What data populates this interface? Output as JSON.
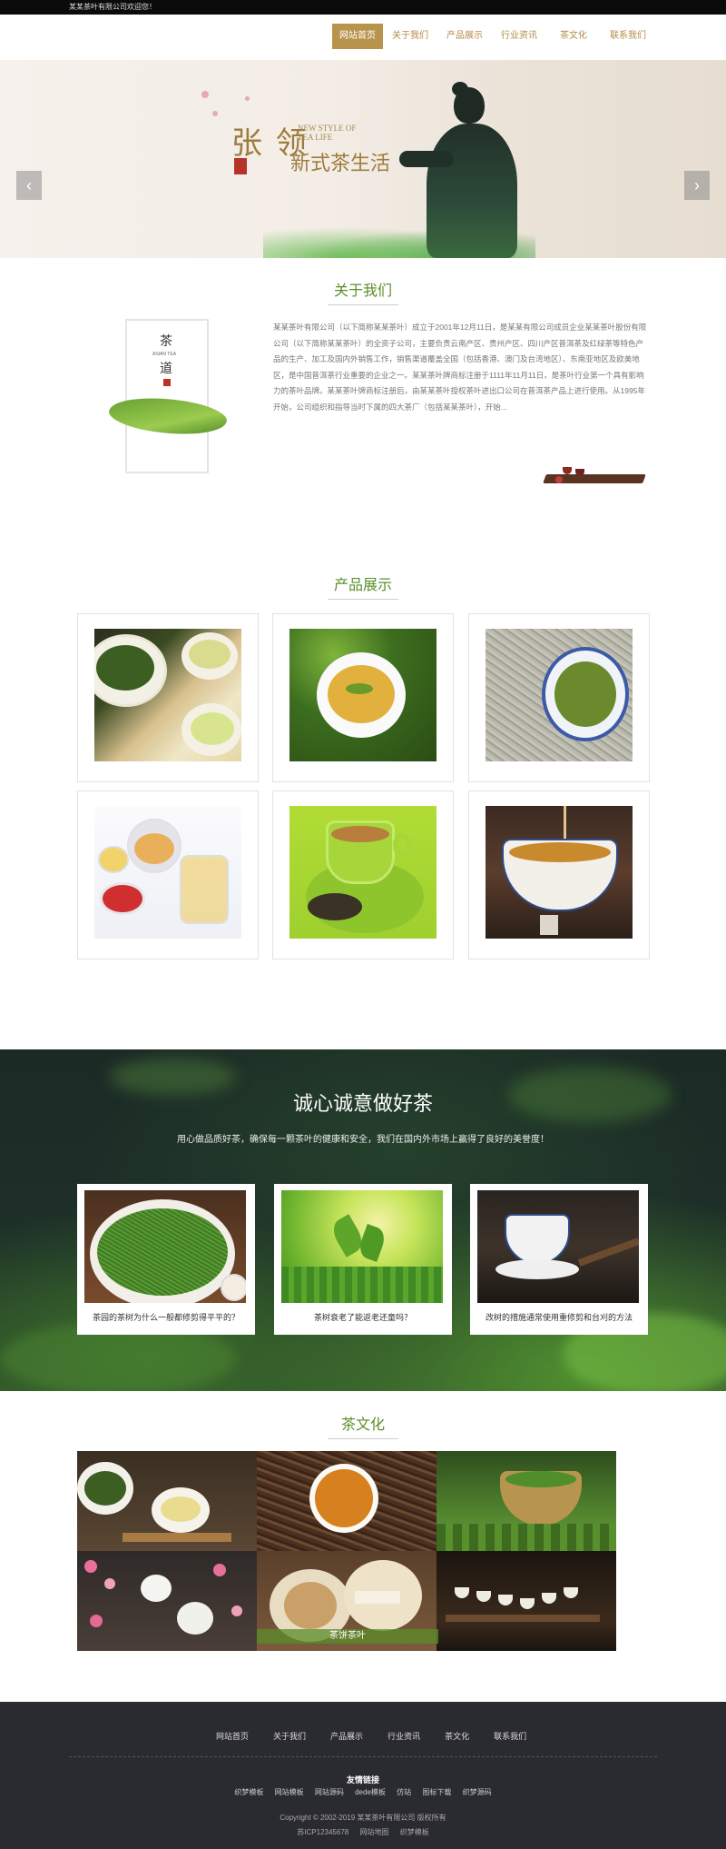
{
  "topbar": {
    "welcome": "某某茶叶有限公司欢迎您！"
  },
  "nav": {
    "items": [
      "网站首页",
      "关于我们",
      "产品展示",
      "行业资讯",
      "茶文化",
      "联系我们"
    ],
    "active": 0
  },
  "banner": {
    "slogan_en": "NEW STYLE OF TEA LIFE",
    "slogan_cn_1": "张 领",
    "slogan_cn_2": "新式茶生活",
    "arrow_left": "‹",
    "arrow_right": "›"
  },
  "about": {
    "title": "关于我们",
    "paragraph": "某某茶叶有限公司（以下简称某某茶叶）成立于2001年12月11日，是某某有限公司成员企业某某茶叶股份有限公司（以下简称某某茶叶）的全资子公司，主要负责云南产区、贵州产区、四川产区普洱茶及红绿茶等特色产品的生产、加工及国内外销售工作，销售渠道覆盖全国（包括香港、澳门及台湾地区）、东南亚地区及欧美地区，是中国普洱茶行业重要的企业之一。某某茶叶牌商标注册于1111年11月11日，是茶叶行业第一个具有影响力的茶叶品牌。某某茶叶牌商标注册后，由某某茶叶授权茶叶进出口公司在普洱茶产品上进行使用。从1995年开始，公司组织和指导当时下属的四大茶厂（包括某某茶叶），开始...",
    "image_chars": [
      "茶",
      "道"
    ],
    "image_small": "ASIAN TEA"
  },
  "products": {
    "title": "产品展示",
    "items": [
      "green-tea-bowls",
      "tea-cup-leaves",
      "dry-tea-bowl",
      "flower-tea-set",
      "green-cup",
      "pouring-tea"
    ]
  },
  "promo": {
    "heading": "诚心诚意做好茶",
    "subheading": "用心做品质好茶，确保每一颗茶叶的健康和安全，我们在国内外市场上赢得了良好的美誉度！",
    "news": [
      {
        "caption": "茶园的茶树为什么一般都修剪得平平的？"
      },
      {
        "caption": "茶树衰老了能返老还童吗？"
      },
      {
        "caption": "改树的措施通常使用重修剪和台刈的方法"
      }
    ]
  },
  "culture": {
    "title": "茶文化",
    "overlay_label": "茶饼茶叶"
  },
  "footer": {
    "nav": [
      "网站首页",
      "关于我们",
      "产品展示",
      "行业资讯",
      "茶文化",
      "联系我们"
    ],
    "links_title": "友情链接",
    "links": [
      "织梦模板",
      "网站模板",
      "网站源码",
      "dede模板",
      "仿站",
      "图标下载",
      "织梦源码"
    ],
    "copyright": "Copyright © 2002-2019 某某茶叶有限公司 版权所有",
    "icp": "苏ICP12345678",
    "sitemap": "网站地图",
    "template": "织梦模板"
  }
}
